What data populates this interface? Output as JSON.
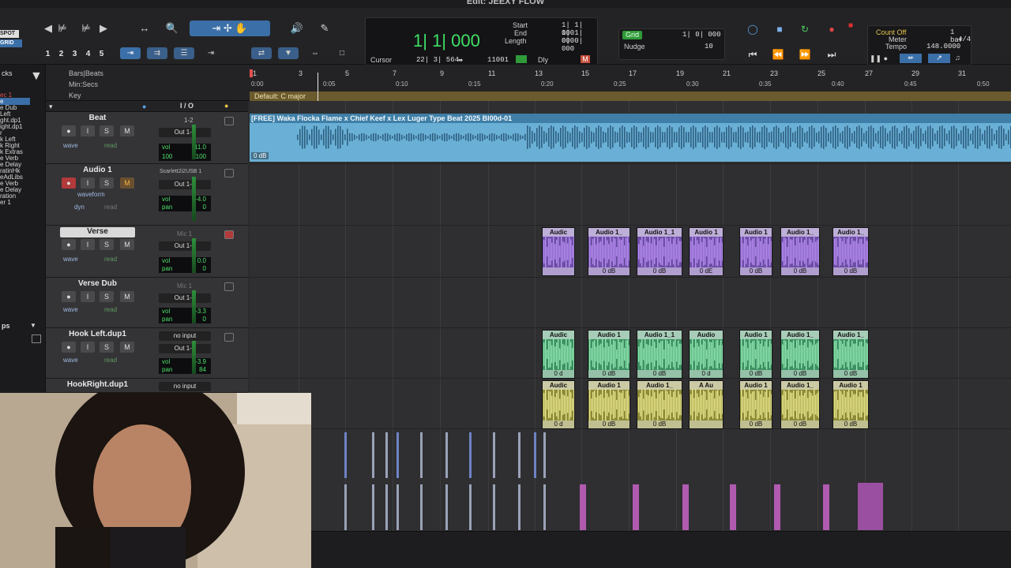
{
  "window": {
    "title": "Edit: JEEXY FLOW"
  },
  "toolbar": {
    "spot_label": "SPOT",
    "grid_label": "GRID",
    "zoom_presets": [
      "1",
      "2",
      "3",
      "4",
      "5"
    ],
    "counter": {
      "main": "1| 1| 000",
      "start_label": "Start",
      "end_label": "End",
      "length_label": "Length",
      "start_value": "1| 1| 000",
      "end_value": "1| 1| 000",
      "length_value": "0| 0| 000",
      "cursor_label": "Cursor",
      "cursor_value": "22| 3| 564",
      "sample_value": "11001",
      "dly_label": "Dly"
    },
    "grid": {
      "tag": "Grid",
      "value": "1| 0| 000",
      "nudge_label": "Nudge",
      "nudge_value": "10"
    },
    "count": {
      "count_off": "Count Off",
      "meter_label": "Meter",
      "tempo_label": "Tempo",
      "bar_value": "1 bar",
      "meter_value": "4/4",
      "tempo_value": "148.0000"
    }
  },
  "rulers": {
    "bars_label": "Bars|Beats",
    "minsecs_label": "Min:Secs",
    "key_label": "Key",
    "key_value": "Default: C major",
    "bars": [
      "1",
      "3",
      "5",
      "7",
      "9",
      "11",
      "13",
      "15",
      "17",
      "19",
      "21",
      "23",
      "25",
      "27",
      "29",
      "31"
    ],
    "times": [
      "0:00",
      "0:05",
      "0:10",
      "0:15",
      "0:20",
      "0:25",
      "0:30",
      "0:35",
      "0:40",
      "0:45",
      "0:50"
    ]
  },
  "leftlist": {
    "header": "cks",
    "items": [
      "ec 1",
      "e",
      "e Dub",
      "Left",
      "ght.dp1",
      "ight.dp1",
      "r",
      "k Left",
      "k Right",
      "k Extras",
      "e Verb",
      "e Delay",
      "ratinHk",
      "eAdLibs",
      "e Verb",
      "e Delay",
      "ration",
      "er 1"
    ],
    "footer": "ps"
  },
  "io_header": "I / O",
  "tracks": [
    {
      "name": "Beat",
      "io_in": "1-2",
      "io_out": "Out 1-2",
      "mode": "wave",
      "auto": "read",
      "vol": "-11.0",
      "pan_label": "100",
      "pan_right": "100"
    },
    {
      "name": "Audio 1",
      "io_in": "Scarlett2i2USB 1",
      "io_out": "Out 1-2",
      "mode": "waveform",
      "auto": "read",
      "vol": "-4.0",
      "pan": "0",
      "sub1": "dyn"
    },
    {
      "name": "Verse",
      "io_in": "Mic 1",
      "io_out": "Out 1-2",
      "mode": "wave",
      "auto": "read",
      "vol": "0.0",
      "pan": "0"
    },
    {
      "name": "Verse Dub",
      "io_in": "Mic 1",
      "io_out": "Out 1-2",
      "mode": "wave",
      "auto": "read",
      "vol": "-3.3",
      "pan": "0"
    },
    {
      "name": "Hook Left.dup1",
      "io_in": "no input",
      "io_out": "Out 1-2",
      "mode": "wave",
      "auto": "read",
      "vol": "-3.9",
      "pan": "84"
    },
    {
      "name": "HookRight.dup1",
      "io_in": "no input"
    }
  ],
  "beat_clip": {
    "title": "[FREE] Waka Flocka Flame x Chief Keef x Lex Luger Type Beat 2025 Bl00d-01",
    "gain": "0 dB"
  },
  "verse_clips": [
    {
      "title": "Audic",
      "gain": ""
    },
    {
      "title": "Audio 1_",
      "gain": "0 dB"
    },
    {
      "title": "Audio 1_1",
      "gain": "0 dB"
    },
    {
      "title": "Audio 1",
      "gain": "0 dE"
    },
    {
      "title": "Audio 1",
      "gain": "0 dB"
    },
    {
      "title": "Audio 1_",
      "gain": "0 dB"
    },
    {
      "title": "Audio 1_",
      "gain": "0 dB"
    }
  ],
  "hookl_clips": [
    {
      "title": "Audic",
      "gain": "0 d"
    },
    {
      "title": "Audio 1",
      "gain": "0 dB"
    },
    {
      "title": "Audio 1_1",
      "gain": "0 dB"
    },
    {
      "title": "Audio",
      "gain": "0 d"
    },
    {
      "title": "Audio 1",
      "gain": "0 dB"
    },
    {
      "title": "Audio 1_",
      "gain": "0 dB"
    },
    {
      "title": "Audio 1_",
      "gain": "0 dB"
    }
  ],
  "hookr_clips": [
    {
      "title": "Audic",
      "gain": "0 d"
    },
    {
      "title": "Audio 1",
      "gain": "0 dB"
    },
    {
      "title": "Audio 1_",
      "gain": "0 dB"
    },
    {
      "title": "A Au",
      "gain": ""
    },
    {
      "title": "Audio 1",
      "gain": "0 dB"
    },
    {
      "title": "Audio 1_",
      "gain": "0 dB"
    },
    {
      "title": "Audio 1",
      "gain": "0 dB"
    }
  ],
  "colors": {
    "accent": "#3b6fa8",
    "beat": "#6ab0d6",
    "verse": "#6d4fa6",
    "hook_left": "#3d8f62",
    "hook_right": "#8c8a38",
    "counter": "#3fe065"
  }
}
